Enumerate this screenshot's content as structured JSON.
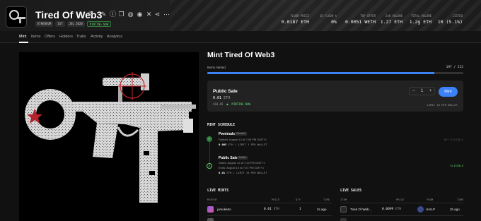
{
  "collection": {
    "title": "Tired Of Web3",
    "badges": [
      "ETHEREUM",
      "1ST",
      "JUL 2020",
      "MINTING NOW"
    ]
  },
  "stats": [
    {
      "label": "FLOOR PRICE",
      "value": "0.0187 ETH"
    },
    {
      "label": "1D FLOOR %",
      "value": "0%"
    },
    {
      "label": "TOP OFFER",
      "value": "0.0051 WETH"
    },
    {
      "label": "24H VOLUME",
      "value": "1.27 ETH"
    },
    {
      "label": "TOTAL VOLUME",
      "value": "1.2g ETH"
    },
    {
      "label": "LISTED",
      "value": "10 (5.1%)"
    }
  ],
  "tabs": [
    "Mint",
    "Items",
    "Offers",
    "Holders",
    "Traits",
    "Activity",
    "Analytics"
  ],
  "mint": {
    "title": "Mint Tired Of Web3",
    "minted_label": "Items minted",
    "minted_count": "197 / 222",
    "progress": 0.887,
    "sale": {
      "title": "Public Sale",
      "price": "0.01",
      "unit": "ETH",
      "usd": "$18.85",
      "status": "MINTING NOW",
      "quantity": "1",
      "minus": "−",
      "plus": "+",
      "button": "Mint",
      "limit": "LIMIT 10 PER WALLET"
    }
  },
  "schedule": {
    "title": "MINT SCHEDULE",
    "phases": [
      {
        "name": "Pwnimals",
        "badge": "Allowlist",
        "line1": "Started: August 12 at 7:05 PM GMT+1",
        "price": "0.005",
        "unit": "ETH",
        "limit": "LIMIT 1 PER WALLET",
        "status": "NOT ELIGIBLE"
      },
      {
        "name": "Public Sale",
        "badge": "Public",
        "line1": "Starts: August 12 at 7:20 PM GMT+1",
        "line2": "Ends: August 13 at 7:21 PM GMT+1",
        "price": "0.01",
        "unit": "ETH",
        "limit": "LIMIT 10 PER WALLET",
        "status": "ELIGIBLE"
      }
    ]
  },
  "live_mints": {
    "title": "LIVE MINTS",
    "headers": [
      "MINTER",
      "PRICE",
      "QTY",
      "TIME"
    ],
    "rows": [
      {
        "minter": "jomokerto",
        "price": "0.01",
        "unit": "ETH",
        "qty": "1",
        "time": "2s ago"
      }
    ]
  },
  "live_sales": {
    "title": "LIVE SALES",
    "headers": [
      "ITEM",
      "PRICE",
      "FROM",
      "TIME"
    ],
    "rows": [
      {
        "item": "Tired Of Web...",
        "price": "0.0099",
        "unit": "ETH",
        "from": "UAILP",
        "time": "2h ago"
      }
    ]
  },
  "colors": {
    "accent": "#3b82f6",
    "success": "#5fd56f",
    "background": "#111111",
    "card": "#222222"
  },
  "icons": [
    "star-icon",
    "edit-icon",
    "info-icon",
    "copy-icon",
    "globe-icon",
    "discord-icon",
    "x-icon",
    "share-icon",
    "more-icon",
    "check-icon"
  ]
}
